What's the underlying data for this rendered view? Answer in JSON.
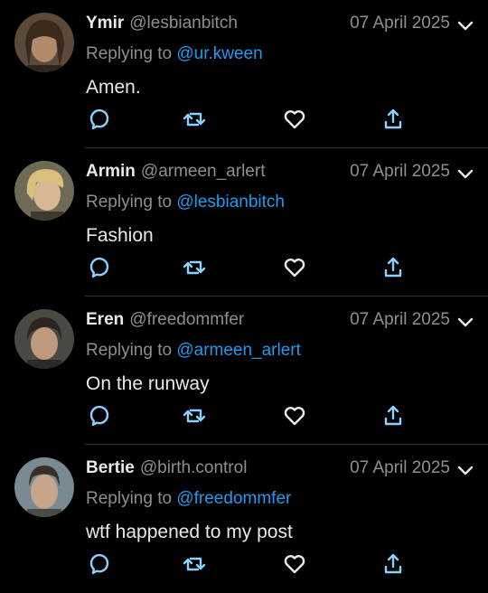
{
  "tweets": [
    {
      "name": "Ymir",
      "handle": "@lesbianbitch",
      "date": "07 April 2025",
      "reply_prefix": "Replying to",
      "reply_to": "@ur.kween",
      "text": "Amen.",
      "avatar": {
        "bg": "#5b4a3a",
        "skin": "#b08a6a",
        "hair": "#3a2a1e"
      }
    },
    {
      "name": "Armin",
      "handle": "@armeen_arlert",
      "date": "07 April 2025",
      "reply_prefix": "Replying to",
      "reply_to": "@lesbianbitch",
      "text": "Fashion",
      "avatar": {
        "bg": "#6d6a58",
        "skin": "#d8b894",
        "hair": "#d9c07a"
      }
    },
    {
      "name": "Eren",
      "handle": "@freedommfer",
      "date": "07 April 2025",
      "reply_prefix": "Replying to",
      "reply_to": "@armeen_arlert",
      "text": "On the runway",
      "avatar": {
        "bg": "#4a4a44",
        "skin": "#c09a7c",
        "hair": "#2b2420"
      }
    },
    {
      "name": "Bertie",
      "handle": "@birth.control",
      "date": "07 April 2025",
      "reply_prefix": "Replying to",
      "reply_to": "@freedommfer",
      "text": "wtf happened to my post",
      "avatar": {
        "bg": "#7a8a94",
        "skin": "#c6a58a",
        "hair": "#3a2f28"
      }
    }
  ],
  "icons": {
    "reply": "reply-icon",
    "retweet": "retweet-icon",
    "like": "like-icon",
    "share": "share-icon",
    "more": "chevron-down-icon"
  },
  "colors": {
    "background": "#000000",
    "text": "#e7e9ea",
    "secondary": "#8b8f94",
    "mention": "#1d9bf0",
    "icon": "#8bd0ff"
  }
}
